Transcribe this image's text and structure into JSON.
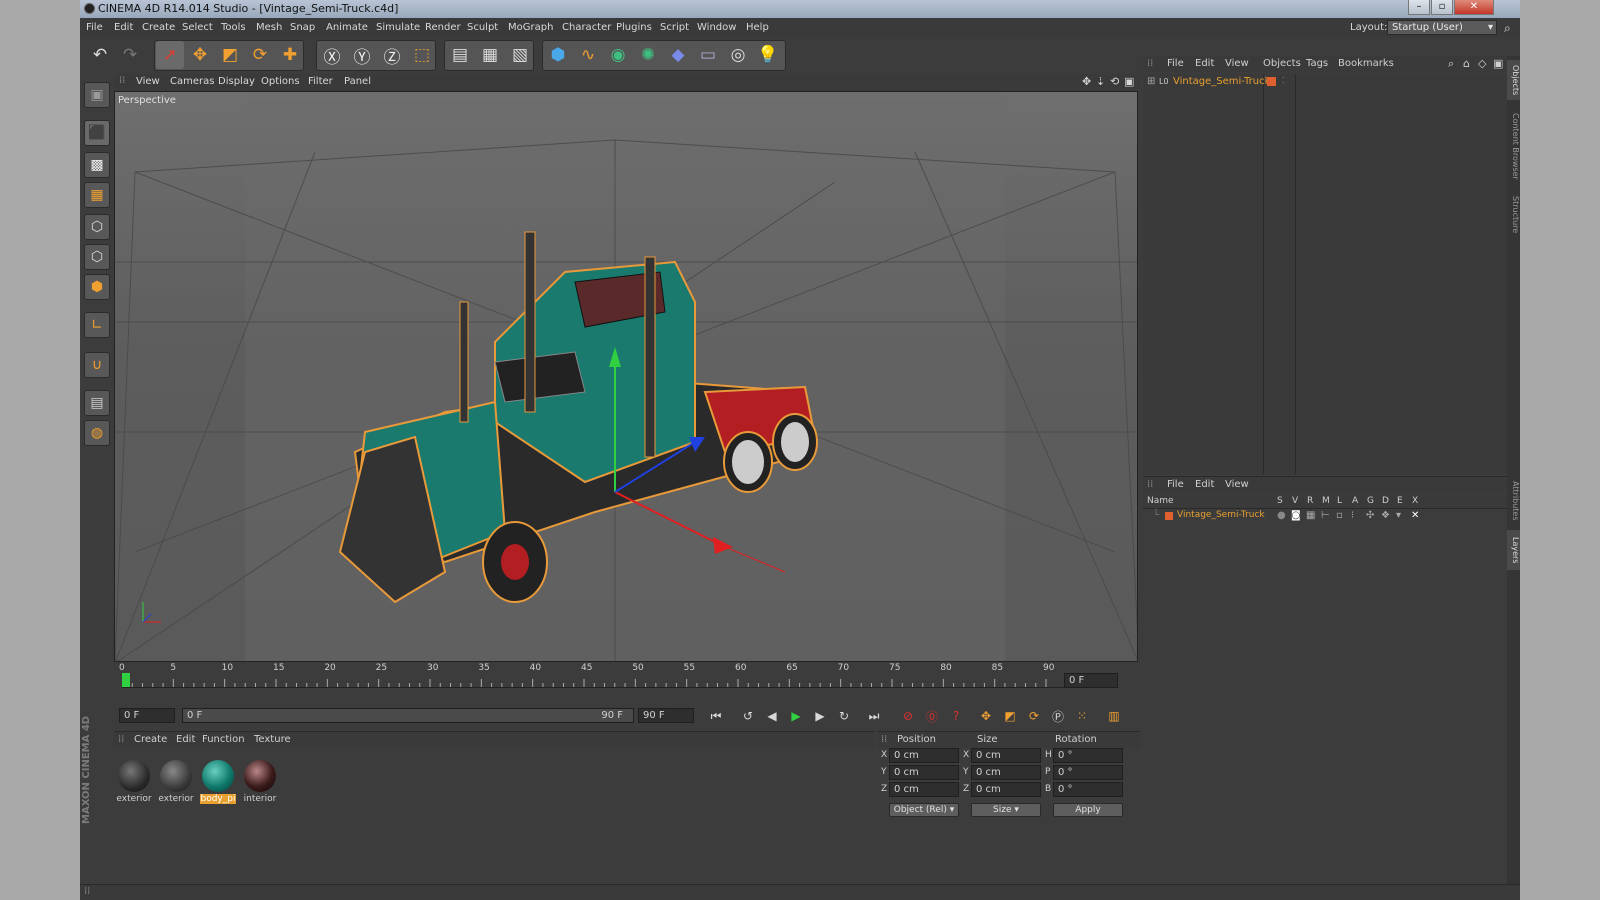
{
  "window": {
    "title": "CINEMA 4D R14.014 Studio - [Vintage_Semi-Truck.c4d]",
    "minimize": "–",
    "maximize": "▫",
    "close": "✕"
  },
  "menubar": {
    "items": [
      "File",
      "Edit",
      "Create",
      "Select",
      "Tools",
      "Mesh",
      "Snap",
      "Animate",
      "Simulate",
      "Render",
      "Sculpt",
      "MoGraph",
      "Character",
      "Plugins",
      "Script",
      "Window",
      "Help"
    ],
    "layout_label": "Layout:",
    "layout_value": "Startup (User)"
  },
  "viewport": {
    "menu": [
      "View",
      "Cameras",
      "Display",
      "Options",
      "Filter",
      "Panel"
    ],
    "label": "Perspective"
  },
  "timeline": {
    "ticks": [
      "0",
      "5",
      "10",
      "15",
      "20",
      "25",
      "30",
      "35",
      "40",
      "45",
      "50",
      "55",
      "60",
      "65",
      "70",
      "75",
      "80",
      "85",
      "90"
    ],
    "current_frame": "0 F",
    "start_field": "0 F",
    "slider_start": "0 F",
    "slider_end": "90 F",
    "end_field": "90 F"
  },
  "materials": {
    "menu": [
      "Create",
      "Edit",
      "Function",
      "Texture"
    ],
    "items": [
      {
        "label": "exterior",
        "color": "#2a2a2a"
      },
      {
        "label": "exterior",
        "color": "#3a3a3a"
      },
      {
        "label": "body_pi",
        "color": "#0f7a6c"
      },
      {
        "label": "interior",
        "color": "#3a1a1a"
      }
    ]
  },
  "coordinates": {
    "headers": [
      "Position",
      "Size",
      "Rotation"
    ],
    "rows": [
      {
        "axis": "X",
        "pos": "0 cm",
        "size_axis": "X",
        "size": "0 cm",
        "rot_axis": "H",
        "rot": "0 °"
      },
      {
        "axis": "Y",
        "pos": "0 cm",
        "size_axis": "Y",
        "size": "0 cm",
        "rot_axis": "P",
        "rot": "0 °"
      },
      {
        "axis": "Z",
        "pos": "0 cm",
        "size_axis": "Z",
        "size": "0 cm",
        "rot_axis": "B",
        "rot": "0 °"
      }
    ],
    "mode_select": "Object (Rel)",
    "size_select": "Size",
    "apply": "Apply"
  },
  "object_manager": {
    "menu": [
      "File",
      "Edit",
      "View",
      "Objects",
      "Tags",
      "Bookmarks"
    ],
    "object_name": "Vintage_Semi-Truck",
    "layer_icon": "L0"
  },
  "layer_manager": {
    "menu": [
      "File",
      "Edit",
      "View"
    ],
    "columns": [
      "Name",
      "S",
      "V",
      "R",
      "M",
      "L",
      "A",
      "G",
      "D",
      "E",
      "X"
    ],
    "layer_name": "Vintage_Semi-Truck"
  },
  "side_tabs": [
    "Objects",
    "Content Browser",
    "Structure",
    "Attributes",
    "Layers"
  ],
  "logo": "MAXON CINEMA 4D",
  "colors": {
    "accent_orange": "#f0a040",
    "selected_object": "#e8a030",
    "truck_teal": "#1a7a6e"
  }
}
